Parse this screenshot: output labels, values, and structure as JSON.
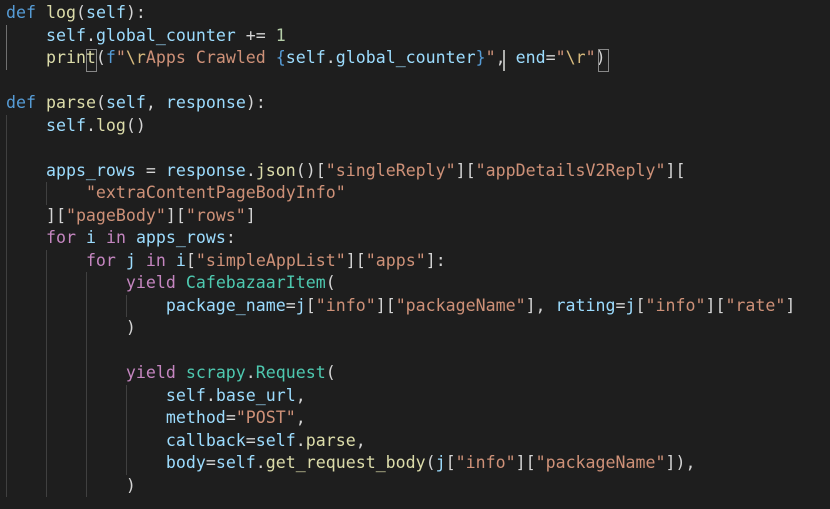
{
  "editor": {
    "theme": {
      "background": "#1e1e1e",
      "foreground": "#d4d4d4"
    },
    "lines": [
      [
        {
          "t": "def",
          "c": "kw"
        },
        {
          "t": " "
        },
        {
          "t": "log",
          "c": "fn"
        },
        {
          "t": "("
        },
        {
          "t": "self",
          "c": "var"
        },
        {
          "t": "):"
        }
      ],
      [
        {
          "t": "    "
        },
        {
          "t": "self",
          "c": "var"
        },
        {
          "t": "."
        },
        {
          "t": "global_counter",
          "c": "var"
        },
        {
          "t": " += "
        },
        {
          "t": "1",
          "c": "num"
        }
      ],
      [
        {
          "t": "    "
        },
        {
          "t": "print",
          "c": "fn"
        },
        {
          "t": "("
        },
        {
          "t": "f",
          "c": "kw"
        },
        {
          "t": "\"",
          "c": "str"
        },
        {
          "t": "\\r",
          "c": "esc"
        },
        {
          "t": "Apps Crawled ",
          "c": "str"
        },
        {
          "t": "{",
          "c": "kw"
        },
        {
          "t": "self",
          "c": "var"
        },
        {
          "t": "."
        },
        {
          "t": "global_counter",
          "c": "var"
        },
        {
          "t": "}",
          "c": "kw"
        },
        {
          "t": "\"",
          "c": "str"
        },
        {
          "t": ", "
        },
        {
          "t": "end",
          "c": "var"
        },
        {
          "t": "="
        },
        {
          "t": "\"",
          "c": "str"
        },
        {
          "t": "\\r",
          "c": "esc"
        },
        {
          "t": "\"",
          "c": "str"
        },
        {
          "t": ")"
        }
      ],
      [],
      [
        {
          "t": "def",
          "c": "kw"
        },
        {
          "t": " "
        },
        {
          "t": "parse",
          "c": "fn"
        },
        {
          "t": "("
        },
        {
          "t": "self",
          "c": "var"
        },
        {
          "t": ", "
        },
        {
          "t": "response",
          "c": "var"
        },
        {
          "t": "):"
        }
      ],
      [
        {
          "t": "    "
        },
        {
          "t": "self",
          "c": "var"
        },
        {
          "t": "."
        },
        {
          "t": "log",
          "c": "fn"
        },
        {
          "t": "()"
        }
      ],
      [],
      [
        {
          "t": "    "
        },
        {
          "t": "apps_rows",
          "c": "var"
        },
        {
          "t": " = "
        },
        {
          "t": "response",
          "c": "var"
        },
        {
          "t": "."
        },
        {
          "t": "json",
          "c": "fn"
        },
        {
          "t": "()["
        },
        {
          "t": "\"singleReply\"",
          "c": "str"
        },
        {
          "t": "]["
        },
        {
          "t": "\"appDetailsV2Reply\"",
          "c": "str"
        },
        {
          "t": "]["
        }
      ],
      [
        {
          "t": "        "
        },
        {
          "t": "\"extraContentPageBodyInfo\"",
          "c": "str"
        }
      ],
      [
        {
          "t": "    ]["
        },
        {
          "t": "\"pageBody\"",
          "c": "str"
        },
        {
          "t": "]["
        },
        {
          "t": "\"rows\"",
          "c": "str"
        },
        {
          "t": "]"
        }
      ],
      [
        {
          "t": "    "
        },
        {
          "t": "for",
          "c": "ctl"
        },
        {
          "t": " "
        },
        {
          "t": "i",
          "c": "var"
        },
        {
          "t": " "
        },
        {
          "t": "in",
          "c": "ctl"
        },
        {
          "t": " "
        },
        {
          "t": "apps_rows",
          "c": "var"
        },
        {
          "t": ":"
        }
      ],
      [
        {
          "t": "        "
        },
        {
          "t": "for",
          "c": "ctl"
        },
        {
          "t": " "
        },
        {
          "t": "j",
          "c": "var"
        },
        {
          "t": " "
        },
        {
          "t": "in",
          "c": "ctl"
        },
        {
          "t": " "
        },
        {
          "t": "i",
          "c": "var"
        },
        {
          "t": "["
        },
        {
          "t": "\"simpleAppList\"",
          "c": "str"
        },
        {
          "t": "]["
        },
        {
          "t": "\"apps\"",
          "c": "str"
        },
        {
          "t": "]:"
        }
      ],
      [
        {
          "t": "            "
        },
        {
          "t": "yield",
          "c": "ctl"
        },
        {
          "t": " "
        },
        {
          "t": "CafebazaarItem",
          "c": "cls"
        },
        {
          "t": "("
        }
      ],
      [
        {
          "t": "                "
        },
        {
          "t": "package_name",
          "c": "var"
        },
        {
          "t": "="
        },
        {
          "t": "j",
          "c": "var"
        },
        {
          "t": "["
        },
        {
          "t": "\"info\"",
          "c": "str"
        },
        {
          "t": "]["
        },
        {
          "t": "\"packageName\"",
          "c": "str"
        },
        {
          "t": "], "
        },
        {
          "t": "rating",
          "c": "var"
        },
        {
          "t": "="
        },
        {
          "t": "j",
          "c": "var"
        },
        {
          "t": "["
        },
        {
          "t": "\"info\"",
          "c": "str"
        },
        {
          "t": "]["
        },
        {
          "t": "\"rate\"",
          "c": "str"
        },
        {
          "t": "]"
        }
      ],
      [
        {
          "t": "            )"
        }
      ],
      [],
      [
        {
          "t": "            "
        },
        {
          "t": "yield",
          "c": "ctl"
        },
        {
          "t": " "
        },
        {
          "t": "scrapy",
          "c": "cls"
        },
        {
          "t": "."
        },
        {
          "t": "Request",
          "c": "cls"
        },
        {
          "t": "("
        }
      ],
      [
        {
          "t": "                "
        },
        {
          "t": "self",
          "c": "var"
        },
        {
          "t": "."
        },
        {
          "t": "base_url",
          "c": "var"
        },
        {
          "t": ","
        }
      ],
      [
        {
          "t": "                "
        },
        {
          "t": "method",
          "c": "var"
        },
        {
          "t": "="
        },
        {
          "t": "\"POST\"",
          "c": "str"
        },
        {
          "t": ","
        }
      ],
      [
        {
          "t": "                "
        },
        {
          "t": "callback",
          "c": "var"
        },
        {
          "t": "="
        },
        {
          "t": "self",
          "c": "var"
        },
        {
          "t": "."
        },
        {
          "t": "parse",
          "c": "fn"
        },
        {
          "t": ","
        }
      ],
      [
        {
          "t": "                "
        },
        {
          "t": "body",
          "c": "var"
        },
        {
          "t": "="
        },
        {
          "t": "self",
          "c": "var"
        },
        {
          "t": "."
        },
        {
          "t": "get_request_body",
          "c": "fn"
        },
        {
          "t": "("
        },
        {
          "t": "j",
          "c": "var"
        },
        {
          "t": "["
        },
        {
          "t": "\"info\"",
          "c": "str"
        },
        {
          "t": "]["
        },
        {
          "t": "\"packageName\"",
          "c": "str"
        },
        {
          "t": "]),"
        }
      ],
      [
        {
          "t": "            )"
        }
      ]
    ]
  }
}
